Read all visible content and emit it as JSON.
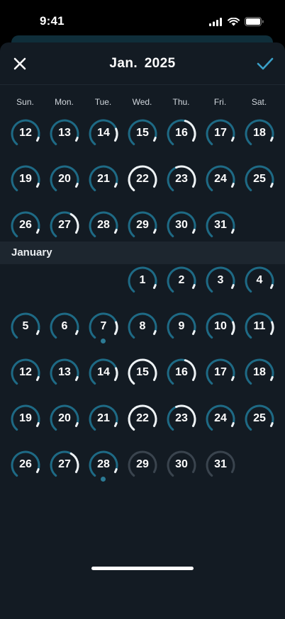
{
  "status_bar": {
    "time": "9:41"
  },
  "header": {
    "title": "Jan.  2025",
    "close_icon": "close-icon",
    "confirm_icon": "checkmark-icon"
  },
  "weekdays": [
    "Sun.",
    "Mon.",
    "Tue.",
    "Wed.",
    "Thu.",
    "Fri.",
    "Sat."
  ],
  "colors": {
    "ring_teal": "#1e6a85",
    "ring_white": "#eef3f6",
    "ring_inactive": "#3a444e",
    "dot": "#2c7a94",
    "background": "#131b23"
  },
  "top_calendar": {
    "days": [
      {
        "label": "12",
        "progress": 0.05,
        "state": "active"
      },
      {
        "label": "13",
        "progress": 0.05,
        "state": "active"
      },
      {
        "label": "14",
        "progress": 0.2,
        "state": "active"
      },
      {
        "label": "15",
        "progress": 0.05,
        "state": "active"
      },
      {
        "label": "16",
        "progress": 0.4,
        "state": "active"
      },
      {
        "label": "17",
        "progress": 0.05,
        "state": "active"
      },
      {
        "label": "18",
        "progress": 0.05,
        "state": "active"
      },
      {
        "label": "19",
        "progress": 0.05,
        "state": "active"
      },
      {
        "label": "20",
        "progress": 0.05,
        "state": "active"
      },
      {
        "label": "21",
        "progress": 0.05,
        "state": "active"
      },
      {
        "label": "22",
        "progress": 1.0,
        "state": "active"
      },
      {
        "label": "23",
        "progress": 0.55,
        "state": "active"
      },
      {
        "label": "24",
        "progress": 0.05,
        "state": "active"
      },
      {
        "label": "25",
        "progress": 0.05,
        "state": "active"
      },
      {
        "label": "26",
        "progress": 0.05,
        "state": "active"
      },
      {
        "label": "27",
        "progress": 0.35,
        "state": "active"
      },
      {
        "label": "28",
        "progress": 0.05,
        "state": "active"
      },
      {
        "label": "29",
        "progress": 0.05,
        "state": "active"
      },
      {
        "label": "30",
        "progress": 0.05,
        "state": "active"
      },
      {
        "label": "31",
        "progress": 0.05,
        "state": "active"
      }
    ]
  },
  "january": {
    "label": "January",
    "days": [
      {
        "label": "1",
        "progress": 0.05,
        "state": "active",
        "dot": false
      },
      {
        "label": "2",
        "progress": 0.05,
        "state": "active",
        "dot": false
      },
      {
        "label": "3",
        "progress": 0.05,
        "state": "active",
        "dot": false
      },
      {
        "label": "4",
        "progress": 0.05,
        "state": "active",
        "dot": false
      },
      {
        "label": "5",
        "progress": 0.05,
        "state": "active",
        "dot": false
      },
      {
        "label": "6",
        "progress": 0.05,
        "state": "active",
        "dot": false
      },
      {
        "label": "7",
        "progress": 0.2,
        "state": "active",
        "dot": true
      },
      {
        "label": "8",
        "progress": 0.05,
        "state": "active",
        "dot": false
      },
      {
        "label": "9",
        "progress": 0.05,
        "state": "active",
        "dot": false
      },
      {
        "label": "10",
        "progress": 0.2,
        "state": "active",
        "dot": false
      },
      {
        "label": "11",
        "progress": 0.2,
        "state": "active",
        "dot": false
      },
      {
        "label": "12",
        "progress": 0.05,
        "state": "active",
        "dot": false
      },
      {
        "label": "13",
        "progress": 0.05,
        "state": "active",
        "dot": false
      },
      {
        "label": "14",
        "progress": 0.2,
        "state": "active",
        "dot": false
      },
      {
        "label": "15",
        "progress": 1.0,
        "state": "active",
        "dot": false
      },
      {
        "label": "16",
        "progress": 0.4,
        "state": "active",
        "dot": false
      },
      {
        "label": "17",
        "progress": 0.05,
        "state": "active",
        "dot": false
      },
      {
        "label": "18",
        "progress": 0.05,
        "state": "active",
        "dot": false
      },
      {
        "label": "19",
        "progress": 0.05,
        "state": "active",
        "dot": false
      },
      {
        "label": "20",
        "progress": 0.05,
        "state": "active",
        "dot": false
      },
      {
        "label": "21",
        "progress": 0.05,
        "state": "active",
        "dot": false
      },
      {
        "label": "22",
        "progress": 1.0,
        "state": "active",
        "dot": false
      },
      {
        "label": "23",
        "progress": 0.55,
        "state": "active",
        "dot": false
      },
      {
        "label": "24",
        "progress": 0.05,
        "state": "active",
        "dot": false
      },
      {
        "label": "25",
        "progress": 0.05,
        "state": "active",
        "dot": false
      },
      {
        "label": "26",
        "progress": 0.05,
        "state": "active",
        "dot": false
      },
      {
        "label": "27",
        "progress": 0.35,
        "state": "active",
        "dot": false
      },
      {
        "label": "28",
        "progress": 0.05,
        "state": "active",
        "dot": true
      },
      {
        "label": "29",
        "progress": 0,
        "state": "future",
        "dot": false
      },
      {
        "label": "30",
        "progress": 0,
        "state": "future",
        "dot": false
      },
      {
        "label": "31",
        "progress": 0,
        "state": "future",
        "dot": false
      }
    ]
  }
}
